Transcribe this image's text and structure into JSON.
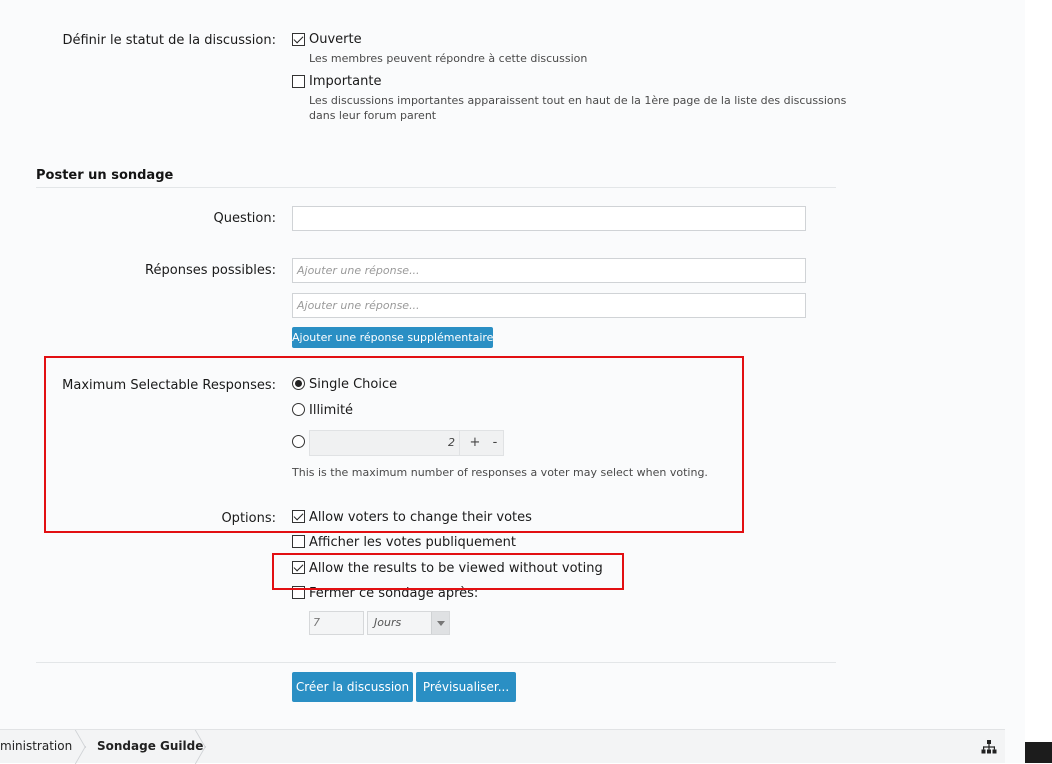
{
  "thread_status": {
    "label": "Définir le statut de la discussion:",
    "open": {
      "label": "Ouverte",
      "hint": "Les membres peuvent répondre à cette discussion",
      "checked": true
    },
    "sticky": {
      "label": "Importante",
      "hint_line1": "Les discussions importantes apparaissent tout en haut de la 1ère page de la liste des discussions",
      "hint_line2": "dans leur forum parent",
      "checked": false
    }
  },
  "poll": {
    "section_title": "Poster un sondage",
    "question_label": "Question:",
    "question_value": "",
    "responses_label": "Réponses possibles:",
    "response_placeholder_1": "Ajouter une réponse...",
    "response_placeholder_2": "Ajouter une réponse...",
    "add_response_button": "Ajouter une réponse supplémentaire",
    "max_label": "Maximum Selectable Responses:",
    "single_choice": "Single Choice",
    "unlimited": "Illimité",
    "max_value": "2",
    "plus": "+",
    "minus": "-",
    "max_hint": "This is the maximum number of responses a voter may select when voting.",
    "options_label": "Options:",
    "opt_change_votes": "Allow voters to change their votes",
    "opt_public_votes": "Afficher les votes publiquement",
    "opt_view_results": "Allow the results to be viewed without voting",
    "opt_close": "Fermer ce sondage après:",
    "close_value": "7",
    "close_unit": "Jours"
  },
  "actions": {
    "create": "Créer la discussion",
    "preview": "Prévisualiser..."
  },
  "breadcrumb": {
    "items": [
      "ministration",
      "Sondage Guilde"
    ]
  },
  "colors": {
    "accent": "#2a8fc4",
    "highlight": "#e20f12"
  }
}
